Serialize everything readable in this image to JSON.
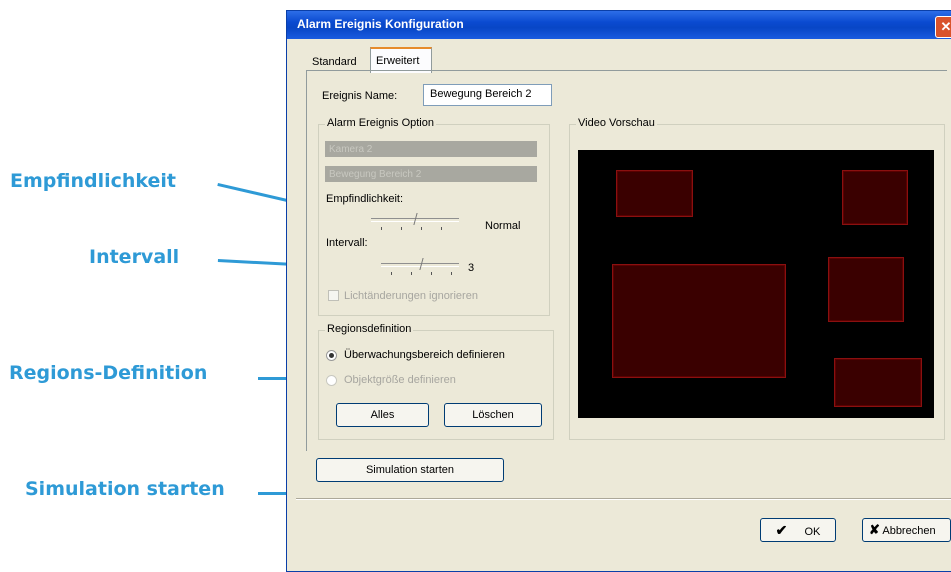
{
  "callouts": {
    "sensitivity": "Empfindlichkeit",
    "interval": "Intervall",
    "regions": "Regions-Definition",
    "simulation": "Simulation starten"
  },
  "window": {
    "title": "Alarm Ereignis Konfiguration",
    "close_glyph": "✕"
  },
  "tabs": [
    "Standard",
    "Erweitert"
  ],
  "event_name": {
    "label": "Ereignis Name:",
    "value": "Bewegung Bereich 2"
  },
  "alarm_option": {
    "title": "Alarm Ereignis Option",
    "camera": "Kamera 2",
    "area": "Bewegung Bereich 2",
    "sensitivity_label": "Empfindlichkeit:",
    "sensitivity_value": "Normal",
    "sensitivity_level": 0.5,
    "interval_label": "Intervall:",
    "interval_value": "3",
    "interval_level": 0.5,
    "checkbox_label": "Lichtänderungen ignorieren"
  },
  "region_def": {
    "title": "Regionsdefinition",
    "option1": "Überwachungsbereich definieren",
    "option2": "Objektgröße definieren",
    "all_button": "Alles",
    "delete_button": "Löschen"
  },
  "video_preview": {
    "title": "Video Vorschau"
  },
  "simulation_button": "Simulation starten",
  "footer": {
    "ok": "OK",
    "ok_glyph": "✔",
    "cancel": "Abbrechen",
    "cancel_glyph": "✘"
  },
  "colors": {
    "callout": "#2e9ad6",
    "title_bar": "#0a4ad0",
    "region_fill": "#3a0000",
    "region_border": "#8a1010"
  }
}
